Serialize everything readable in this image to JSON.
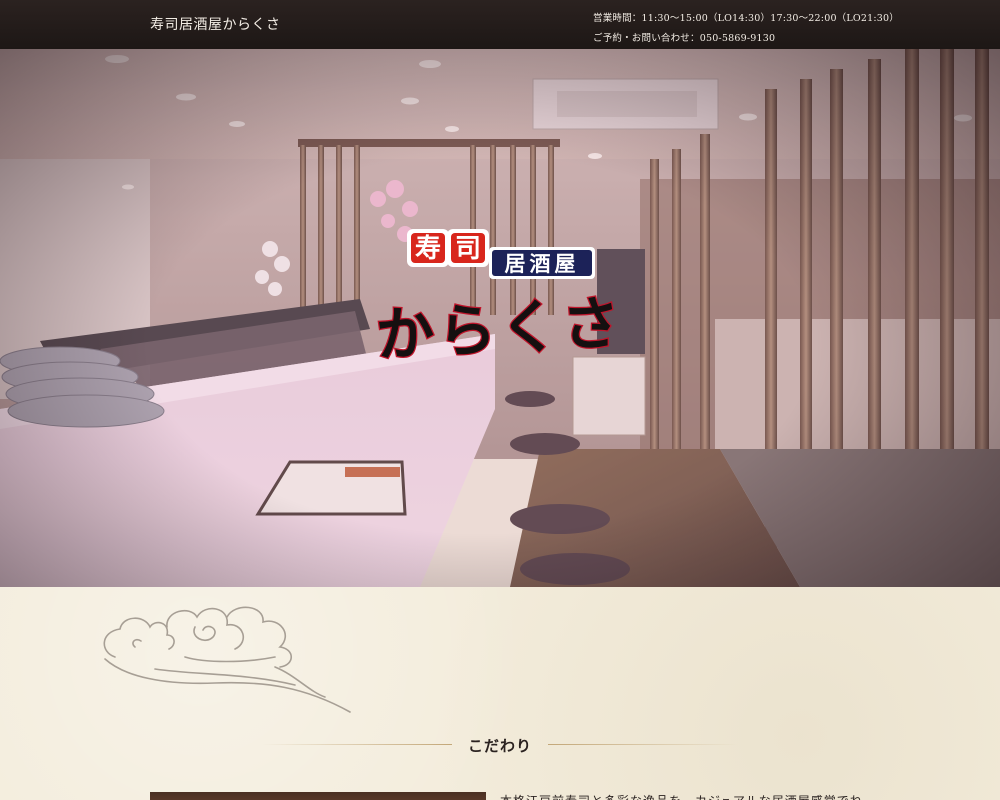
{
  "header": {
    "brand": "寿司居酒屋からくさ",
    "hours": "営業時間：11:30〜15:00（LO14:30）17:30〜22:00（LO21:30）",
    "contact": "ご予約・お問い合わせ：050-5869-9130"
  },
  "hero": {
    "logo_badge_1": "寿",
    "logo_badge_2": "司",
    "logo_subtitle": "居酒屋",
    "logo_name": "からくさ",
    "colors": {
      "badge_red": "#d8261c",
      "badge_navy": "#1c2258",
      "name_black": "#151010"
    }
  },
  "section": {
    "title": "こだわり",
    "intro": "本格江戸前寿司と多彩な逸品を、カジュアルな居酒屋感覚でね"
  },
  "colors": {
    "header_bg": "#231b19",
    "paper_bg": "#f3ecdb",
    "rule_gold": "#bea06e"
  }
}
